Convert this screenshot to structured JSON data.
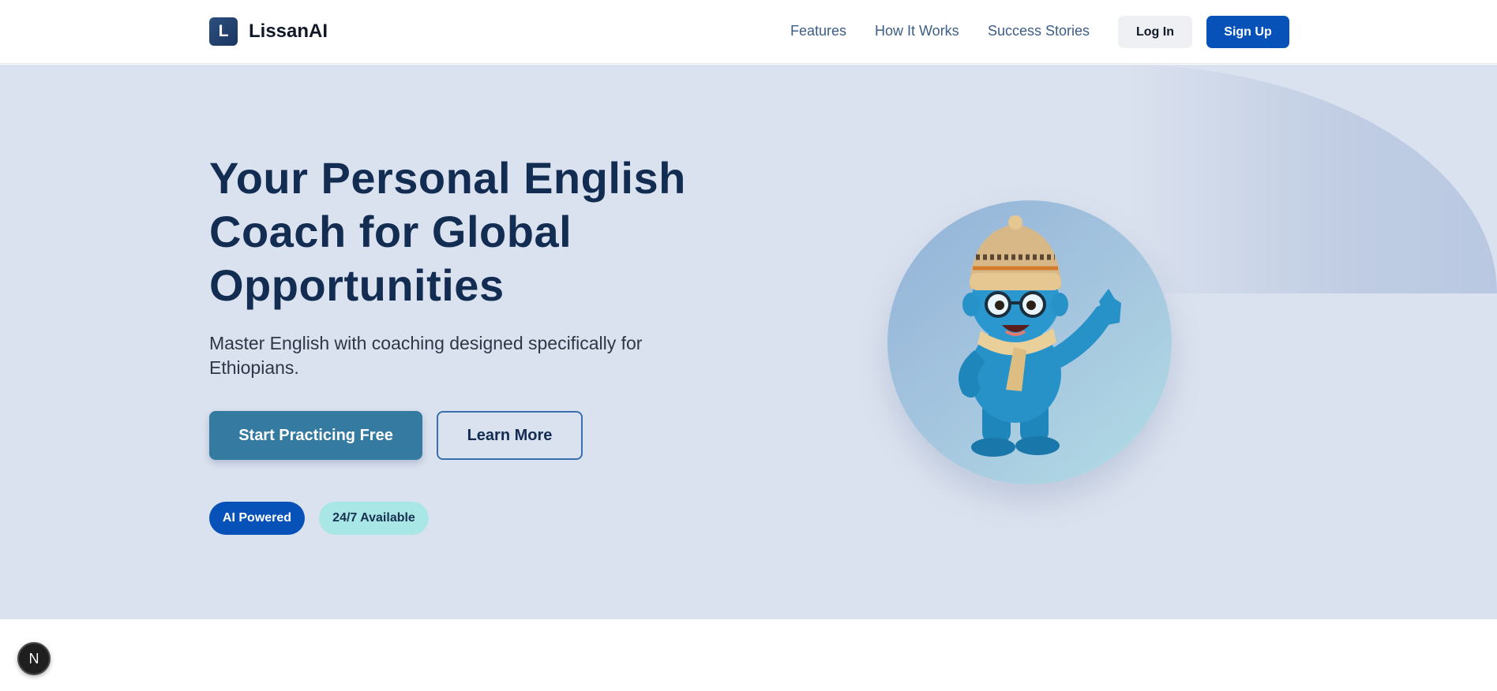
{
  "brand": {
    "logo_letter": "L",
    "name": "LissanAI"
  },
  "nav": {
    "links": [
      "Features",
      "How It Works",
      "Success Stories"
    ],
    "login_label": "Log In",
    "signup_label": "Sign Up"
  },
  "hero": {
    "title": "Your Personal English Coach for Global Opportunities",
    "subtitle": "Master English with coaching designed specifically for Ethiopians.",
    "primary_cta": "Start Practicing Free",
    "secondary_cta": "Learn More",
    "badges": [
      "AI Powered",
      "24/7 Available"
    ]
  },
  "dev_badge": {
    "letter": "N"
  },
  "colors": {
    "brand_blue": "#0652b8",
    "title_navy": "#132d52",
    "hero_bg": "#dbe2ef",
    "cta_teal": "#357aa0",
    "badge_cyan": "#a9e6e6"
  }
}
